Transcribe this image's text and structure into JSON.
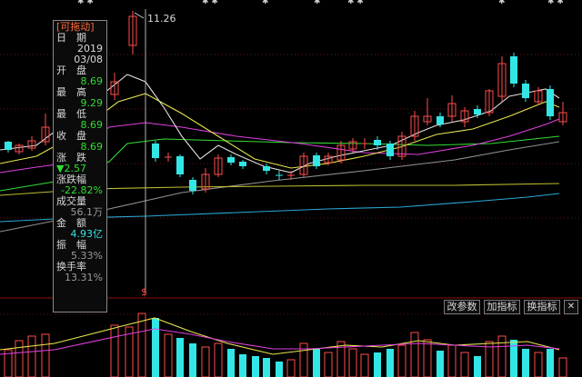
{
  "info_panel": {
    "title": "[可拖动]",
    "date_label": "日　期",
    "date_year": "2019",
    "date_md": "03/08",
    "open_label": "开　盘",
    "open_value": "8.69",
    "high_label": "最　高",
    "high_value": "9.29",
    "low_label": "最　低",
    "low_value": "8.69",
    "close_label": "收　盘",
    "close_value": "8.69",
    "change_label": "涨　跌",
    "change_value": "▼2.57",
    "change_pct_label": "涨跌幅",
    "change_pct_value": "-22.82%",
    "volume_label": "成交量",
    "volume_value": "56.1万",
    "amount_label": "金　额",
    "amount_value": "4.93亿",
    "amplitude_label": "振　幅",
    "amplitude_value": "5.33%",
    "turnover_label": "换手率",
    "turnover_value": "13.31%"
  },
  "annotations": {
    "high_price": "11.26",
    "marker": "$"
  },
  "buttons": {
    "params": "改参数",
    "add_indicator": "加指标",
    "switch_indicator": "换指标"
  },
  "colors": {
    "up": "#ff4d4d",
    "down": "#33e6e6",
    "ma5": "#e0e0e0",
    "ma10": "#e6e64d",
    "ma20": "#e040e0",
    "ma30": "#33dd33",
    "ma60": "#bdbd33",
    "ma120": "#2aa8d8",
    "ma250": "#909090"
  }
}
